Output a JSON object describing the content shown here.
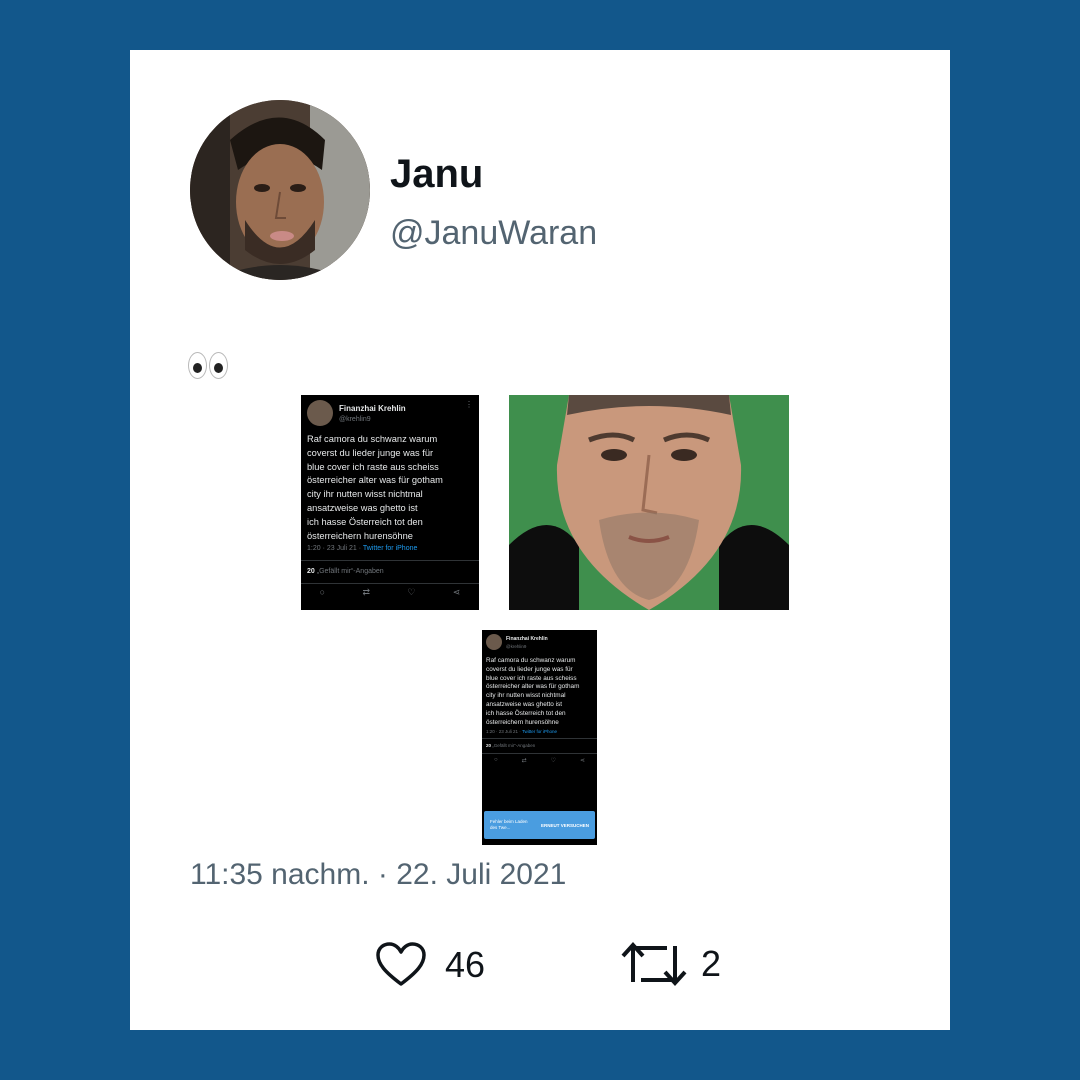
{
  "author": {
    "display_name": "Janu",
    "handle": "@JanuWaran"
  },
  "tweet": {
    "text_emoji_icons": [
      "eye-icon",
      "eye-icon"
    ],
    "timestamp": "11:35 nachm. · 22. Juli 2021",
    "likes": "46",
    "retweets": "2"
  },
  "media": {
    "screenshot": {
      "name": "Finanzhai Krehlin",
      "handle": "@krehlin9",
      "lines": [
        "Raf camora du schwanz warum",
        "coverst du lieder junge was für",
        "blue cover ich raste aus scheiss",
        "österreicher alter was für gotham",
        "city ihr nutten wisst nichtmal",
        "ansatzweise was ghetto ist",
        "ich hasse Österreich tot den",
        "österreichern hurensöhne"
      ],
      "meta_time": "1:20 · 23 Juli 21 · ",
      "meta_source": "Twitter for iPhone",
      "likes_count": "20",
      "likes_label": " „Gefällt mir“-Angaben",
      "error_message": "Fehler beim Laden des Twe...",
      "retry_label": "ERNEUT VERSUCHEN"
    }
  },
  "colors": {
    "background": "#12578b",
    "card": "#ffffff",
    "name": "#0f1419",
    "secondary": "#536471"
  }
}
